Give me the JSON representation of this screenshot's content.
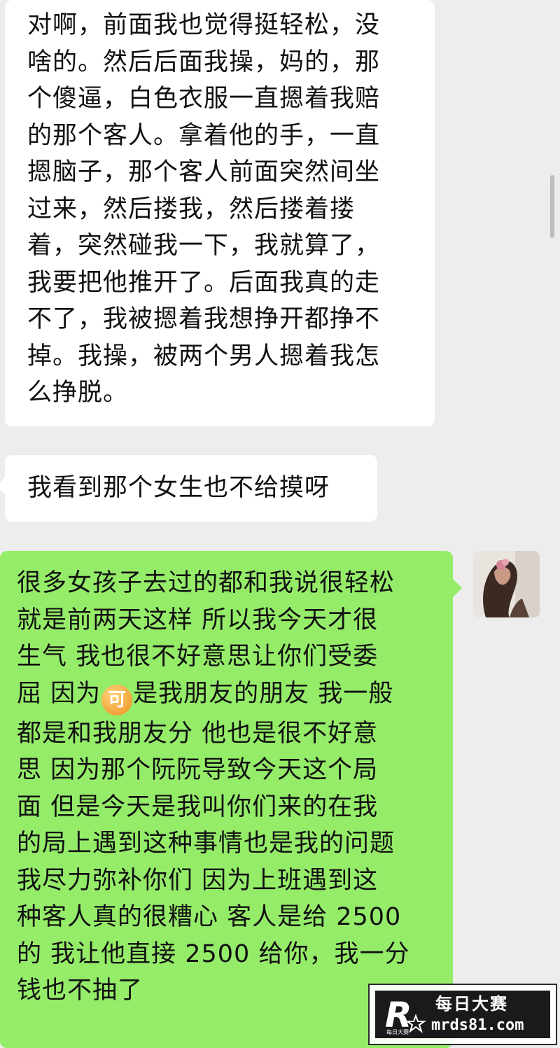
{
  "messages": [
    {
      "side": "incoming",
      "lines": [
        "对啊，前面我也觉得挺轻松，没",
        "啥的。然后后面我操，妈的，那",
        "个傻逼，白色衣服一直摁着我赔",
        "的那个客人。拿着他的手，一直",
        "摁脑子，那个客人前面突然间坐",
        "过来，然后搂我，然后搂着搂",
        "着，突然碰我一下，我就算了，",
        "我要把他推开了。后面我真的走",
        "不了，我被摁着我想挣开都挣不",
        "掉。我操，被两个男人摁着我怎",
        "么挣脱。"
      ]
    },
    {
      "side": "incoming",
      "lines": [
        "我看到那个女生也不给摸呀"
      ]
    },
    {
      "side": "outgoing",
      "lines": [
        "很多女孩子去过的都和我说很轻松",
        "就是前两天这样 所以我今天才很",
        "生气 我也很不好意思让你们受委",
        {
          "before": "屈 因为",
          "emoji": "可",
          "after": "是我朋友的朋友 我一般"
        },
        "都是和我朋友分  他也是很不好意",
        "思 因为那个阮阮导致今天这个局",
        "面 但是今天是我叫你们来的在我",
        "的局上遇到这种事情也是我的问题",
        "我尽力弥补你们  因为上班遇到这",
        "种客人真的很糟心 客人是给 2500",
        "的 我让他直接 2500 给你，我一分",
        "钱也不抽了"
      ]
    }
  ],
  "watermark": {
    "title": "每日大赛",
    "url": "mrds81.com",
    "logo_letter": "R",
    "logo_caption": "每日大赛"
  },
  "colors": {
    "background": "#ededed",
    "incoming_bubble": "#ffffff",
    "outgoing_bubble": "#95ec69"
  }
}
